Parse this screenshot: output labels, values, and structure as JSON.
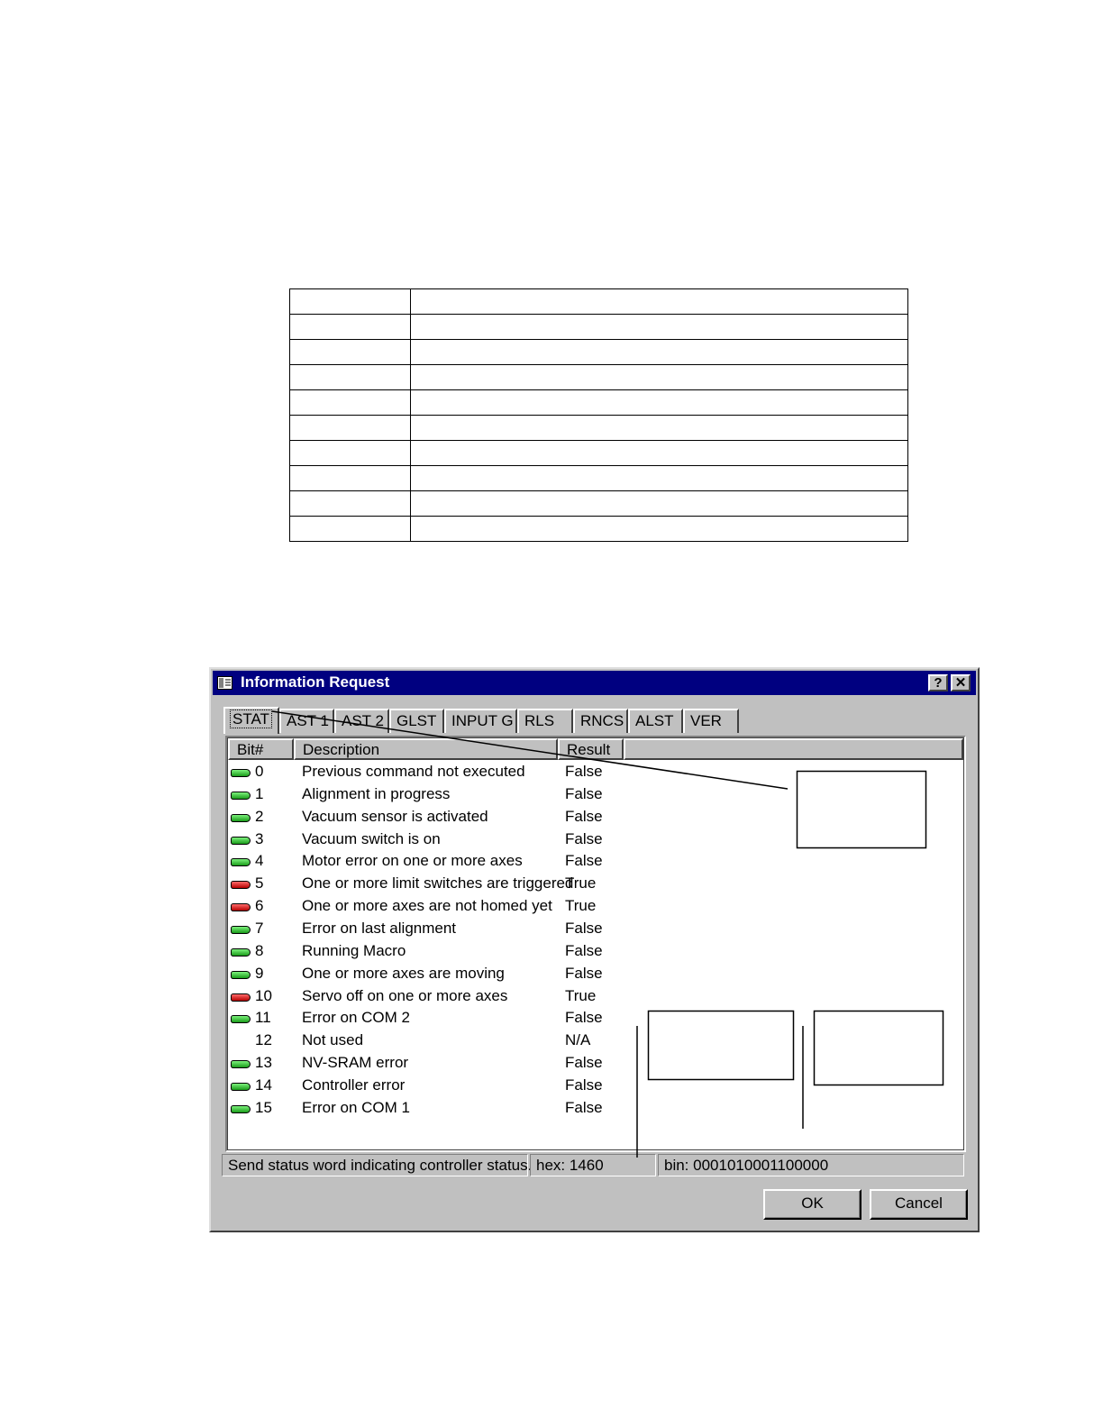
{
  "doc_table": {
    "rows": 10
  },
  "dialog": {
    "title": "Information Request",
    "help_glyph": "?",
    "close_glyph": "✕",
    "tabs": [
      "STAT",
      "AST 1",
      "AST 2",
      "GLST",
      "INPUT G",
      "RLS",
      "RNCS",
      "ALST",
      "VER"
    ],
    "active_tab": "STAT",
    "columns": {
      "bit": "Bit#",
      "description": "Description",
      "result": "Result"
    },
    "rows": [
      {
        "bit": "0",
        "description": "Previous command not executed",
        "result": "False",
        "led": "green"
      },
      {
        "bit": "1",
        "description": "Alignment in progress",
        "result": "False",
        "led": "green"
      },
      {
        "bit": "2",
        "description": "Vacuum sensor is activated",
        "result": "False",
        "led": "green"
      },
      {
        "bit": "3",
        "description": "Vacuum switch is on",
        "result": "False",
        "led": "green"
      },
      {
        "bit": "4",
        "description": "Motor error on one or more axes",
        "result": "False",
        "led": "green"
      },
      {
        "bit": "5",
        "description": "One or more limit switches are triggered",
        "result": "True",
        "led": "red"
      },
      {
        "bit": "6",
        "description": "One or more axes are not homed yet",
        "result": "True",
        "led": "red"
      },
      {
        "bit": "7",
        "description": "Error on last alignment",
        "result": "False",
        "led": "green"
      },
      {
        "bit": "8",
        "description": "Running Macro",
        "result": "False",
        "led": "green"
      },
      {
        "bit": "9",
        "description": "One or more axes are moving",
        "result": "False",
        "led": "green"
      },
      {
        "bit": "10",
        "description": "Servo off on one or more axes",
        "result": "True",
        "led": "red"
      },
      {
        "bit": "11",
        "description": "Error on COM 2",
        "result": "False",
        "led": "green"
      },
      {
        "bit": "12",
        "description": "Not used",
        "result": "N/A",
        "led": "none"
      },
      {
        "bit": "13",
        "description": "NV-SRAM error",
        "result": "False",
        "led": "green"
      },
      {
        "bit": "14",
        "description": "Controller error",
        "result": "False",
        "led": "green"
      },
      {
        "bit": "15",
        "description": "Error on COM 1",
        "result": "False",
        "led": "green"
      }
    ],
    "status": {
      "message": "Send status word indicating controller status.",
      "hex": "hex: 1460",
      "bin": "bin: 0001010001100000"
    },
    "buttons": {
      "ok": "OK",
      "cancel": "Cancel"
    }
  },
  "colors": {
    "titlebar": "#000080",
    "face": "#c0c0c0",
    "led_green": "#22b022",
    "led_red": "#d00000"
  }
}
